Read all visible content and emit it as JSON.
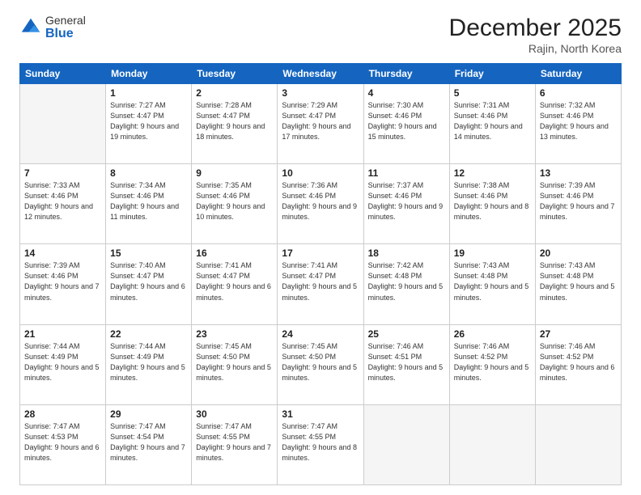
{
  "logo": {
    "general": "General",
    "blue": "Blue"
  },
  "header": {
    "month_year": "December 2025",
    "location": "Rajin, North Korea"
  },
  "weekdays": [
    "Sunday",
    "Monday",
    "Tuesday",
    "Wednesday",
    "Thursday",
    "Friday",
    "Saturday"
  ],
  "weeks": [
    [
      {
        "day": "",
        "empty": true
      },
      {
        "day": "1",
        "sunrise": "7:27 AM",
        "sunset": "4:47 PM",
        "daylight": "9 hours and 19 minutes."
      },
      {
        "day": "2",
        "sunrise": "7:28 AM",
        "sunset": "4:47 PM",
        "daylight": "9 hours and 18 minutes."
      },
      {
        "day": "3",
        "sunrise": "7:29 AM",
        "sunset": "4:47 PM",
        "daylight": "9 hours and 17 minutes."
      },
      {
        "day": "4",
        "sunrise": "7:30 AM",
        "sunset": "4:46 PM",
        "daylight": "9 hours and 15 minutes."
      },
      {
        "day": "5",
        "sunrise": "7:31 AM",
        "sunset": "4:46 PM",
        "daylight": "9 hours and 14 minutes."
      },
      {
        "day": "6",
        "sunrise": "7:32 AM",
        "sunset": "4:46 PM",
        "daylight": "9 hours and 13 minutes."
      }
    ],
    [
      {
        "day": "7",
        "sunrise": "7:33 AM",
        "sunset": "4:46 PM",
        "daylight": "9 hours and 12 minutes."
      },
      {
        "day": "8",
        "sunrise": "7:34 AM",
        "sunset": "4:46 PM",
        "daylight": "9 hours and 11 minutes."
      },
      {
        "day": "9",
        "sunrise": "7:35 AM",
        "sunset": "4:46 PM",
        "daylight": "9 hours and 10 minutes."
      },
      {
        "day": "10",
        "sunrise": "7:36 AM",
        "sunset": "4:46 PM",
        "daylight": "9 hours and 9 minutes."
      },
      {
        "day": "11",
        "sunrise": "7:37 AM",
        "sunset": "4:46 PM",
        "daylight": "9 hours and 9 minutes."
      },
      {
        "day": "12",
        "sunrise": "7:38 AM",
        "sunset": "4:46 PM",
        "daylight": "9 hours and 8 minutes."
      },
      {
        "day": "13",
        "sunrise": "7:39 AM",
        "sunset": "4:46 PM",
        "daylight": "9 hours and 7 minutes."
      }
    ],
    [
      {
        "day": "14",
        "sunrise": "7:39 AM",
        "sunset": "4:46 PM",
        "daylight": "9 hours and 7 minutes."
      },
      {
        "day": "15",
        "sunrise": "7:40 AM",
        "sunset": "4:47 PM",
        "daylight": "9 hours and 6 minutes."
      },
      {
        "day": "16",
        "sunrise": "7:41 AM",
        "sunset": "4:47 PM",
        "daylight": "9 hours and 6 minutes."
      },
      {
        "day": "17",
        "sunrise": "7:41 AM",
        "sunset": "4:47 PM",
        "daylight": "9 hours and 5 minutes."
      },
      {
        "day": "18",
        "sunrise": "7:42 AM",
        "sunset": "4:48 PM",
        "daylight": "9 hours and 5 minutes."
      },
      {
        "day": "19",
        "sunrise": "7:43 AM",
        "sunset": "4:48 PM",
        "daylight": "9 hours and 5 minutes."
      },
      {
        "day": "20",
        "sunrise": "7:43 AM",
        "sunset": "4:48 PM",
        "daylight": "9 hours and 5 minutes."
      }
    ],
    [
      {
        "day": "21",
        "sunrise": "7:44 AM",
        "sunset": "4:49 PM",
        "daylight": "9 hours and 5 minutes."
      },
      {
        "day": "22",
        "sunrise": "7:44 AM",
        "sunset": "4:49 PM",
        "daylight": "9 hours and 5 minutes."
      },
      {
        "day": "23",
        "sunrise": "7:45 AM",
        "sunset": "4:50 PM",
        "daylight": "9 hours and 5 minutes."
      },
      {
        "day": "24",
        "sunrise": "7:45 AM",
        "sunset": "4:50 PM",
        "daylight": "9 hours and 5 minutes."
      },
      {
        "day": "25",
        "sunrise": "7:46 AM",
        "sunset": "4:51 PM",
        "daylight": "9 hours and 5 minutes."
      },
      {
        "day": "26",
        "sunrise": "7:46 AM",
        "sunset": "4:52 PM",
        "daylight": "9 hours and 5 minutes."
      },
      {
        "day": "27",
        "sunrise": "7:46 AM",
        "sunset": "4:52 PM",
        "daylight": "9 hours and 6 minutes."
      }
    ],
    [
      {
        "day": "28",
        "sunrise": "7:47 AM",
        "sunset": "4:53 PM",
        "daylight": "9 hours and 6 minutes."
      },
      {
        "day": "29",
        "sunrise": "7:47 AM",
        "sunset": "4:54 PM",
        "daylight": "9 hours and 7 minutes."
      },
      {
        "day": "30",
        "sunrise": "7:47 AM",
        "sunset": "4:55 PM",
        "daylight": "9 hours and 7 minutes."
      },
      {
        "day": "31",
        "sunrise": "7:47 AM",
        "sunset": "4:55 PM",
        "daylight": "9 hours and 8 minutes."
      },
      {
        "day": "",
        "empty": true
      },
      {
        "day": "",
        "empty": true
      },
      {
        "day": "",
        "empty": true
      }
    ]
  ]
}
